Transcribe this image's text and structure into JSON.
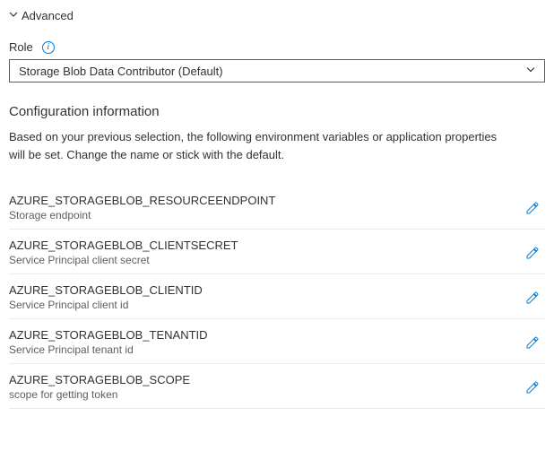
{
  "section": {
    "title": "Advanced"
  },
  "role": {
    "label": "Role",
    "selected": "Storage Blob Data Contributor (Default)"
  },
  "config": {
    "heading": "Configuration information",
    "description": "Based on your previous selection, the following environment variables or application properties will be set. Change the name or stick with the default."
  },
  "vars": [
    {
      "name": "AZURE_STORAGEBLOB_RESOURCEENDPOINT",
      "desc": "Storage endpoint"
    },
    {
      "name": "AZURE_STORAGEBLOB_CLIENTSECRET",
      "desc": "Service Principal client secret"
    },
    {
      "name": "AZURE_STORAGEBLOB_CLIENTID",
      "desc": "Service Principal client id"
    },
    {
      "name": "AZURE_STORAGEBLOB_TENANTID",
      "desc": "Service Principal tenant id"
    },
    {
      "name": "AZURE_STORAGEBLOB_SCOPE",
      "desc": "scope for getting token"
    }
  ]
}
